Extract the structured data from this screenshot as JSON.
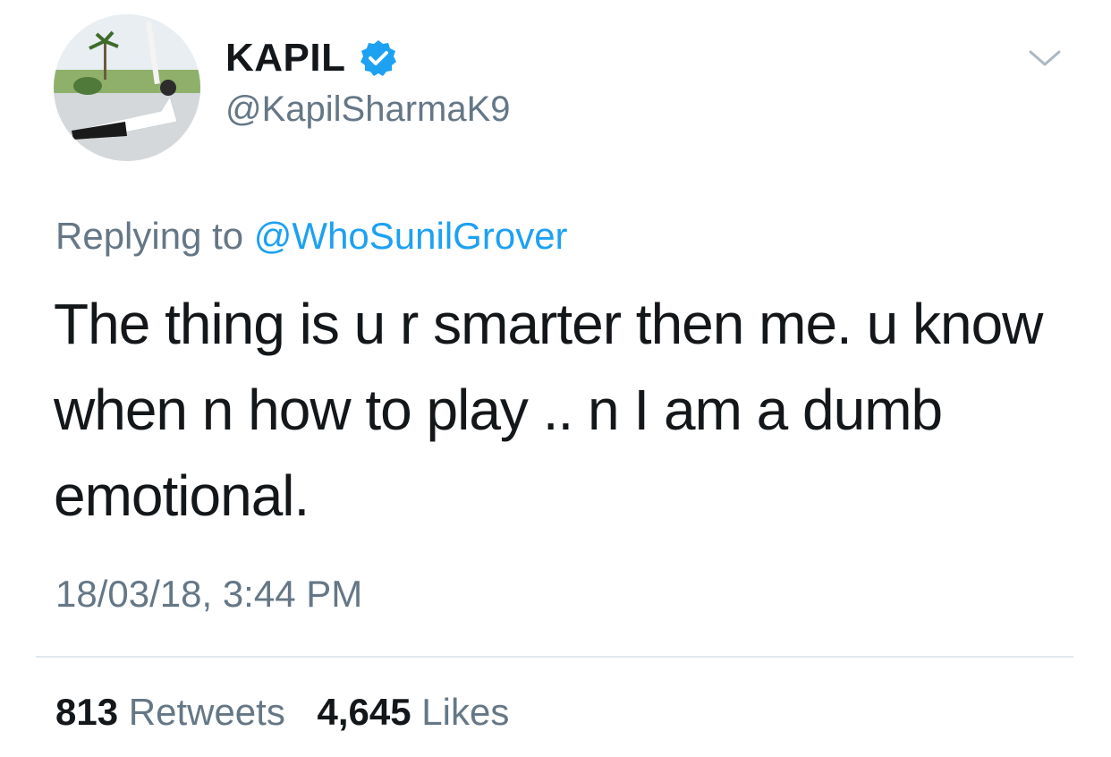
{
  "colors": {
    "accent": "#1da1f2",
    "text_primary": "#14171a",
    "text_secondary": "#657786",
    "divider": "#e1e8ed"
  },
  "author": {
    "display_name": "KAPIL",
    "handle": "@KapilSharmaK9",
    "verified": true,
    "avatar_icon": "user-avatar-photo"
  },
  "menu": {
    "icon": "chevron-down-icon"
  },
  "reply": {
    "prefix": "Replying to",
    "mention": "@WhoSunilGrover"
  },
  "tweet": {
    "text": "The thing is u r smarter then me. u know when n how to play .. n I am a dumb emotional.",
    "timestamp": "18/03/18, 3:44 PM"
  },
  "stats": {
    "retweets_count": "813",
    "retweets_label": "Retweets",
    "likes_count": "4,645",
    "likes_label": "Likes"
  }
}
